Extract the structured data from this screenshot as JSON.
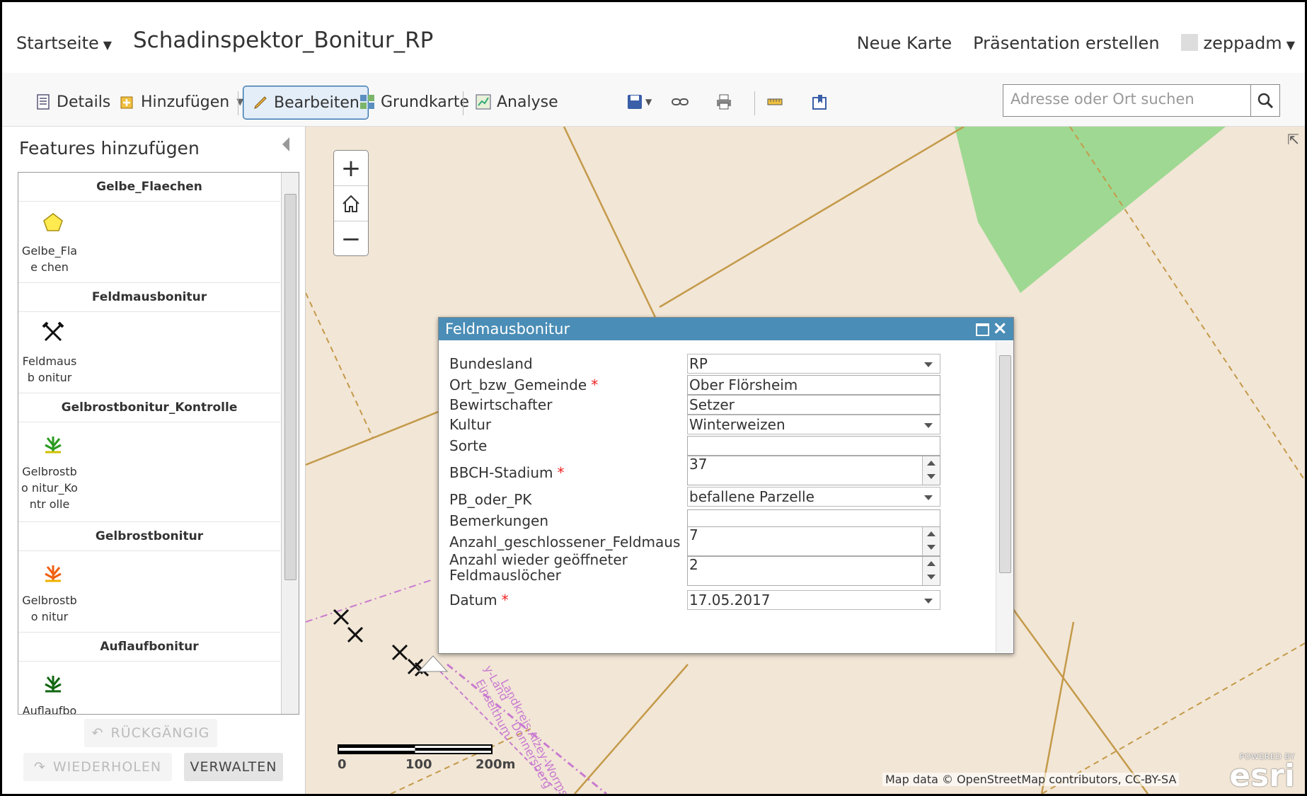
{
  "header": {
    "home_label": "Startseite",
    "map_title": "Schadinspektor_Bonitur_RP",
    "new_map": "Neue Karte",
    "presentation": "Präsentation erstellen",
    "user": "zeppadm"
  },
  "toolbar": {
    "details": "Details",
    "add": "Hinzufügen",
    "edit": "Bearbeiten",
    "basemap": "Grundkarte",
    "analysis": "Analyse",
    "search_placeholder": "Adresse oder Ort suchen"
  },
  "panel": {
    "title": "Features hinzufügen",
    "groups": [
      {
        "header": "Gelbe_Flaechen",
        "label": "Gelbe_Flae chen"
      },
      {
        "header": "Feldmausbonitur",
        "label": "Feldmausb onitur"
      },
      {
        "header": "Gelbrostbonitur_Kontrolle",
        "label": "Gelbrostbo nitur_Kontr olle"
      },
      {
        "header": "Gelbrostbonitur",
        "label": "Gelbrostbo nitur"
      },
      {
        "header": "Auflaufbonitur",
        "label": "Auflaufbon"
      }
    ],
    "undo": "RÜCKGÄNGIG",
    "redo": "WIEDERHOLEN",
    "manage": "VERWALTEN"
  },
  "map": {
    "attribution": "Map data © OpenStreetMap contributors, CC-BY-SA",
    "esri_powered": "POWERED BY",
    "esri_logo": "esri",
    "scale": [
      "0",
      "100",
      "200m"
    ],
    "labels": [
      "Landkreis Alzey-Worms",
      "Einselthum",
      "Donnersberg",
      "y-Land"
    ]
  },
  "popup": {
    "title": "Feldmausbonitur",
    "fields": [
      {
        "label": "Bundesland",
        "value": "RP",
        "type": "select",
        "required": false
      },
      {
        "label": "Ort_bzw_Gemeinde",
        "value": "Ober Flörsheim",
        "type": "text",
        "required": true
      },
      {
        "label": "Bewirtschafter",
        "value": "Setzer",
        "type": "text",
        "required": false
      },
      {
        "label": "Kultur",
        "value": "Winterweizen",
        "type": "select",
        "required": false
      },
      {
        "label": "Sorte",
        "value": "",
        "type": "text",
        "required": false
      },
      {
        "label": "BBCH-Stadium",
        "value": "37",
        "type": "spin",
        "required": true
      },
      {
        "label": "PB_oder_PK",
        "value": "befallene Parzelle",
        "type": "select",
        "required": false
      },
      {
        "label": "Bemerkungen",
        "value": "",
        "type": "text",
        "required": false
      },
      {
        "label": "Anzahl_geschlossener_Feldmaus",
        "value": "7",
        "type": "spin",
        "required": false
      },
      {
        "label": "Anzahl wieder geöffneter",
        "label2": "Feldmauslöcher",
        "value": "2",
        "type": "spin",
        "required": false
      },
      {
        "label": "Datum",
        "value": "17.05.2017",
        "type": "select",
        "required": true
      }
    ],
    "required_mark": "*"
  },
  "colors": {
    "map_bg": "#f2e6d6",
    "popup_header": "#4a8db6",
    "road": "#c49a4a",
    "forest": "#9fd892",
    "boundary": "#c87ad0"
  }
}
